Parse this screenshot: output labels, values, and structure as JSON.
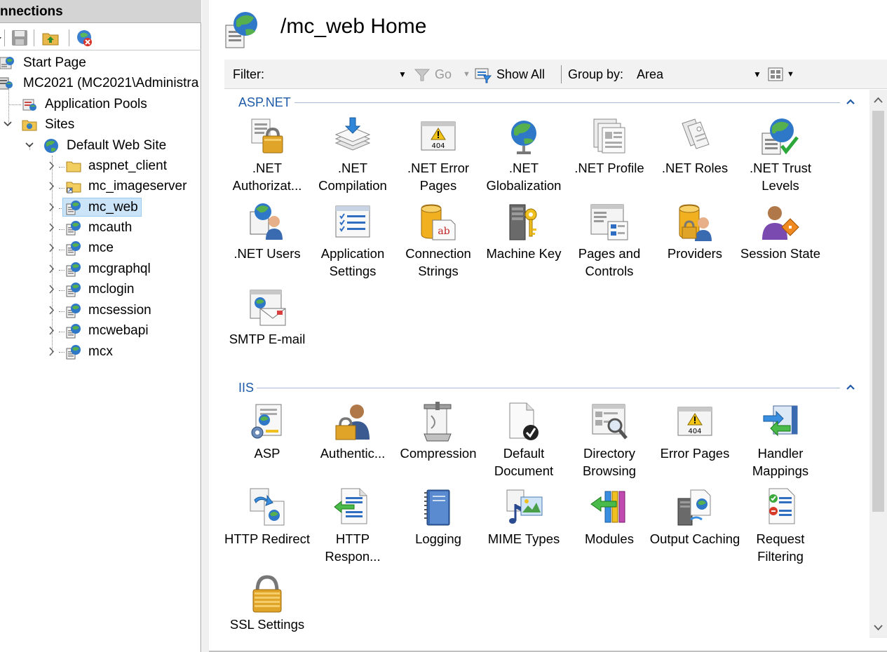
{
  "connections": {
    "header_title": "nnections",
    "tree": [
      {
        "label": "Start Page",
        "icon": "start-page-icon",
        "level": 0
      },
      {
        "label": "MC2021 (MC2021\\Administra",
        "icon": "server-icon",
        "level": 0
      },
      {
        "label": "Application Pools",
        "icon": "app-pool-icon",
        "level": 1
      },
      {
        "label": "Sites",
        "icon": "sites-folder-icon",
        "level": 1
      },
      {
        "label": "Default Web Site",
        "icon": "globe-icon",
        "level": 2
      },
      {
        "label": "aspnet_client",
        "icon": "folder-icon",
        "level": 3
      },
      {
        "label": "mc_imageserver",
        "icon": "virtual-dir-icon",
        "level": 3
      },
      {
        "label": "mc_web",
        "icon": "web-app-icon",
        "level": 3,
        "selected": true
      },
      {
        "label": "mcauth",
        "icon": "web-app-icon",
        "level": 3
      },
      {
        "label": "mce",
        "icon": "web-app-icon",
        "level": 3
      },
      {
        "label": "mcgraphql",
        "icon": "web-app-icon",
        "level": 3
      },
      {
        "label": "mclogin",
        "icon": "web-app-icon",
        "level": 3
      },
      {
        "label": "mcsession",
        "icon": "web-app-icon",
        "level": 3
      },
      {
        "label": "mcwebapi",
        "icon": "web-app-icon",
        "level": 3
      },
      {
        "label": "mcx",
        "icon": "web-app-icon",
        "level": 3
      }
    ]
  },
  "page": {
    "title": "/mc_web Home"
  },
  "filter_bar": {
    "filter_label": "Filter:",
    "filter_value": "",
    "go_label": "Go",
    "show_all_label": "Show All",
    "group_by_label": "Group by:",
    "group_by_value": "Area"
  },
  "groups": [
    {
      "title": "ASP.NET",
      "features": [
        {
          "label": ".NET Authorizat...",
          "icon": "net-authorization-icon"
        },
        {
          "label": ".NET Compilation",
          "icon": "net-compilation-icon"
        },
        {
          "label": ".NET Error Pages",
          "icon": "net-error-pages-icon"
        },
        {
          "label": ".NET Globalization",
          "icon": "net-globalization-icon"
        },
        {
          "label": ".NET Profile",
          "icon": "net-profile-icon"
        },
        {
          "label": ".NET Roles",
          "icon": "net-roles-icon"
        },
        {
          "label": ".NET Trust Levels",
          "icon": "net-trust-levels-icon"
        },
        {
          "label": ".NET Users",
          "icon": "net-users-icon"
        },
        {
          "label": "Application Settings",
          "icon": "application-settings-icon"
        },
        {
          "label": "Connection Strings",
          "icon": "connection-strings-icon"
        },
        {
          "label": "Machine Key",
          "icon": "machine-key-icon"
        },
        {
          "label": "Pages and Controls",
          "icon": "pages-and-controls-icon"
        },
        {
          "label": "Providers",
          "icon": "providers-icon"
        },
        {
          "label": "Session State",
          "icon": "session-state-icon"
        },
        {
          "label": "SMTP E-mail",
          "icon": "smtp-email-icon"
        }
      ]
    },
    {
      "title": "IIS",
      "features": [
        {
          "label": "ASP",
          "icon": "asp-icon"
        },
        {
          "label": "Authentic...",
          "icon": "authentication-icon"
        },
        {
          "label": "Compression",
          "icon": "compression-icon"
        },
        {
          "label": "Default Document",
          "icon": "default-document-icon"
        },
        {
          "label": "Directory Browsing",
          "icon": "directory-browsing-icon"
        },
        {
          "label": "Error Pages",
          "icon": "error-pages-icon"
        },
        {
          "label": "Handler Mappings",
          "icon": "handler-mappings-icon"
        },
        {
          "label": "HTTP Redirect",
          "icon": "http-redirect-icon"
        },
        {
          "label": "HTTP Respon...",
          "icon": "http-response-headers-icon"
        },
        {
          "label": "Logging",
          "icon": "logging-icon"
        },
        {
          "label": "MIME Types",
          "icon": "mime-types-icon"
        },
        {
          "label": "Modules",
          "icon": "modules-icon"
        },
        {
          "label": "Output Caching",
          "icon": "output-caching-icon"
        },
        {
          "label": "Request Filtering",
          "icon": "request-filtering-icon"
        },
        {
          "label": "SSL Settings",
          "icon": "ssl-settings-icon"
        }
      ]
    }
  ],
  "colors": {
    "group_title": "#1e5aa8",
    "selection_bg": "#cce4f7",
    "header_bg": "#d4d4d4"
  }
}
